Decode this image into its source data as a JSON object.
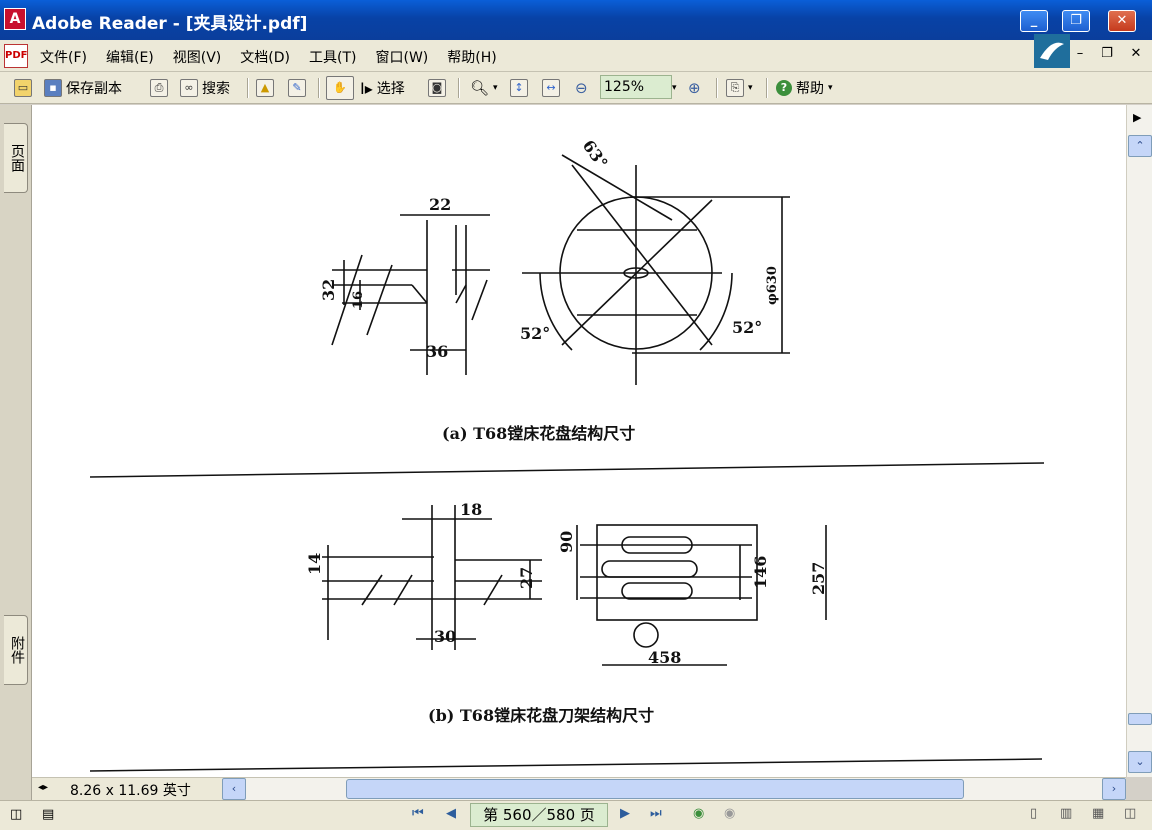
{
  "window": {
    "title": "Adobe Reader - [夹具设计.pdf]"
  },
  "menu": {
    "items": [
      "文件(F)",
      "编辑(E)",
      "视图(V)",
      "文档(D)",
      "工具(T)",
      "窗口(W)",
      "帮助(H)"
    ]
  },
  "toolbar": {
    "save_copy": "保存副本",
    "search": "搜索",
    "select": "选择",
    "zoom": "125%",
    "help": "帮助"
  },
  "side_tabs": {
    "pages": "页面",
    "attachments": "附件"
  },
  "document": {
    "figure_a": {
      "caption": "(a)   T68镗床花盘结构尺寸",
      "dims": [
        "22",
        "32",
        "16",
        "36",
        "63°",
        "φ630",
        "52°",
        "52°"
      ]
    },
    "figure_b": {
      "caption": "(b)   T68镗床花盘刀架结构尺寸",
      "dims": [
        "18",
        "14",
        "27",
        "30",
        "90",
        "146",
        "257",
        "458"
      ]
    }
  },
  "status": {
    "page_size": "8.26 x 11.69 英寸",
    "page_indicator": "第 560／580 页"
  }
}
